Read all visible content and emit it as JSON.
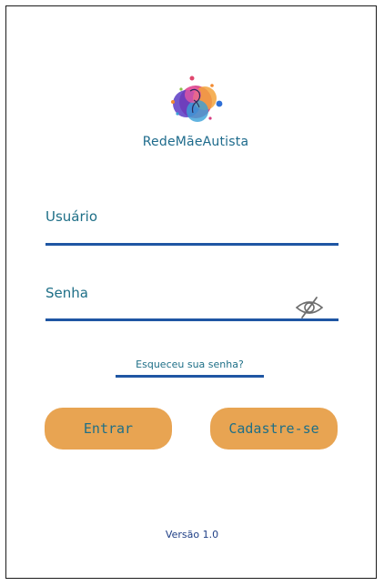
{
  "app": {
    "logo_text": "RedeMãeAutista",
    "logo_icon": "mother-child-watercolor-logo"
  },
  "form": {
    "username_label": "Usuário",
    "username_value": "",
    "password_label": "Senha",
    "password_value": "",
    "visibility_icon": "eye-slash-icon"
  },
  "links": {
    "forgot_password": "Esqueceu sua senha?"
  },
  "buttons": {
    "login": "Entrar",
    "register": "Cadastre-se"
  },
  "footer": {
    "version": "Versão 1.0"
  },
  "colors": {
    "accent_text": "#1e6f87",
    "input_underline": "#1f56a3",
    "button_fill": "#e8a452",
    "version_text": "#1f3f86"
  }
}
